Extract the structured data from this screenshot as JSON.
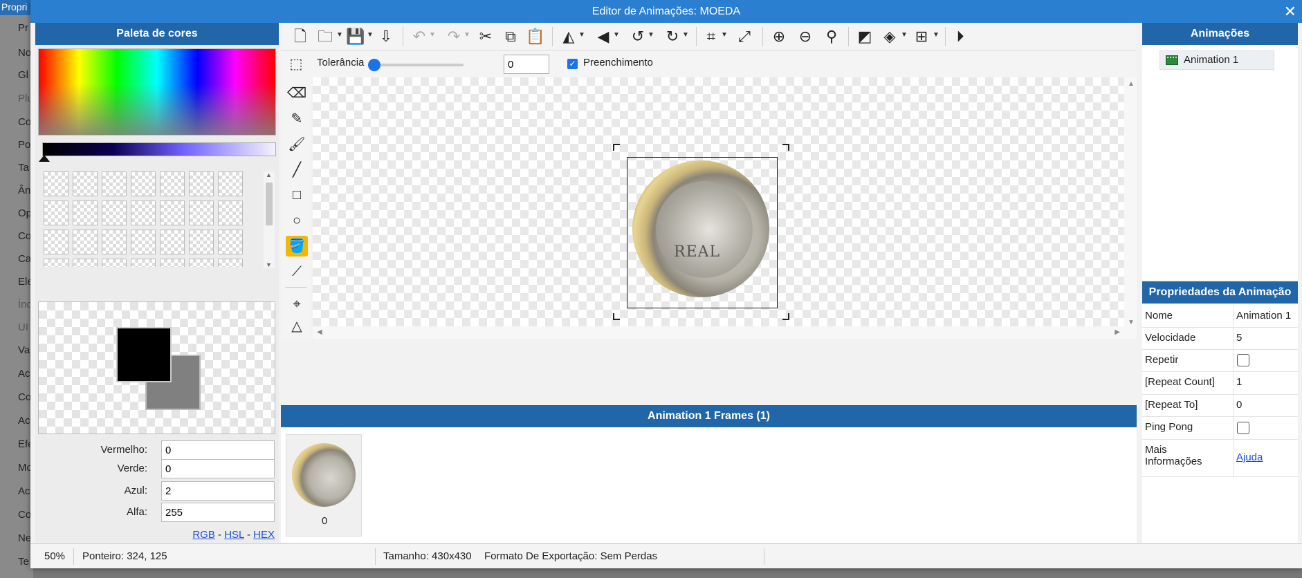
{
  "background": {
    "header": "Propri",
    "items": [
      "Pr",
      "No",
      "Gl",
      "Plu",
      "Co",
      "Po",
      "Ta",
      "Ân",
      "Op",
      "Co",
      "Ca",
      "Ele",
      "Índ",
      "UI",
      "Va",
      "Ac",
      "Co",
      "Ac",
      "Efe",
      "Mo",
      "Ac",
      "Co",
      "Ne",
      "Te"
    ]
  },
  "window": {
    "title": "Editor de Animações: MOEDA",
    "close": "✕"
  },
  "palette": {
    "header": "Paleta de cores",
    "fields": [
      {
        "label": "Vermelho:",
        "value": "0"
      },
      {
        "label": "Verde:",
        "value": "0"
      },
      {
        "label": "Azul:",
        "value": "2"
      },
      {
        "label": "Alfa:",
        "value": "255"
      }
    ],
    "modes": {
      "rgb": "RGB",
      "sep": "-",
      "hsl": "HSL",
      "hex": "HEX"
    },
    "primary_color": "#000000",
    "secondary_color": "#808080"
  },
  "toolbar2": {
    "tolerance_label": "Tolerância",
    "tolerance_value": "0",
    "fill_label": "Preenchimento",
    "fill_checked": true
  },
  "frames": {
    "header": "Animation 1 Frames (1)",
    "items": [
      {
        "index": "0"
      }
    ]
  },
  "animations": {
    "header": "Animações",
    "items": [
      {
        "label": "Animation 1"
      }
    ]
  },
  "properties": {
    "header": "Propriedades da Animação",
    "rows": [
      {
        "key": "Nome",
        "value": "Animation 1"
      },
      {
        "key": "Velocidade",
        "value": "5"
      },
      {
        "key": "Repetir",
        "value": ""
      },
      {
        "key": "[Repeat Count]",
        "value": "1"
      },
      {
        "key": "[Repeat To]",
        "value": "0"
      },
      {
        "key": "Ping Pong",
        "value": ""
      },
      {
        "key_line1": "Mais",
        "key_line2": "Informações",
        "value": "Ajuda"
      }
    ]
  },
  "coin_text": "REAL",
  "status": {
    "zoom": "50%",
    "pointer": "Ponteiro: 324, 125",
    "size": "Tamanho: 430x430",
    "export": "Formato De Exportação: Sem Perdas"
  },
  "icons": {
    "new": "new-file-icon",
    "open": "open-folder-icon",
    "save": "save-icon",
    "export": "export-icon",
    "undo": "undo-icon",
    "redo": "redo-icon",
    "cut": "scissors-icon",
    "copy": "copy-icon",
    "paste": "paste-icon",
    "flip_h": "flip-horizontal-icon",
    "flip_v": "flip-vertical-icon",
    "rotate_ccw": "rotate-ccw-icon",
    "rotate_cw": "rotate-cw-icon",
    "crop": "crop-icon",
    "resize": "resize-icon",
    "zoom_in": "zoom-in-icon",
    "zoom_out": "zoom-out-icon",
    "zoom_fit": "zoom-icon",
    "mask": "mask-icon",
    "layers": "layers-icon",
    "grid": "grid-icon",
    "play": "play-icon"
  }
}
